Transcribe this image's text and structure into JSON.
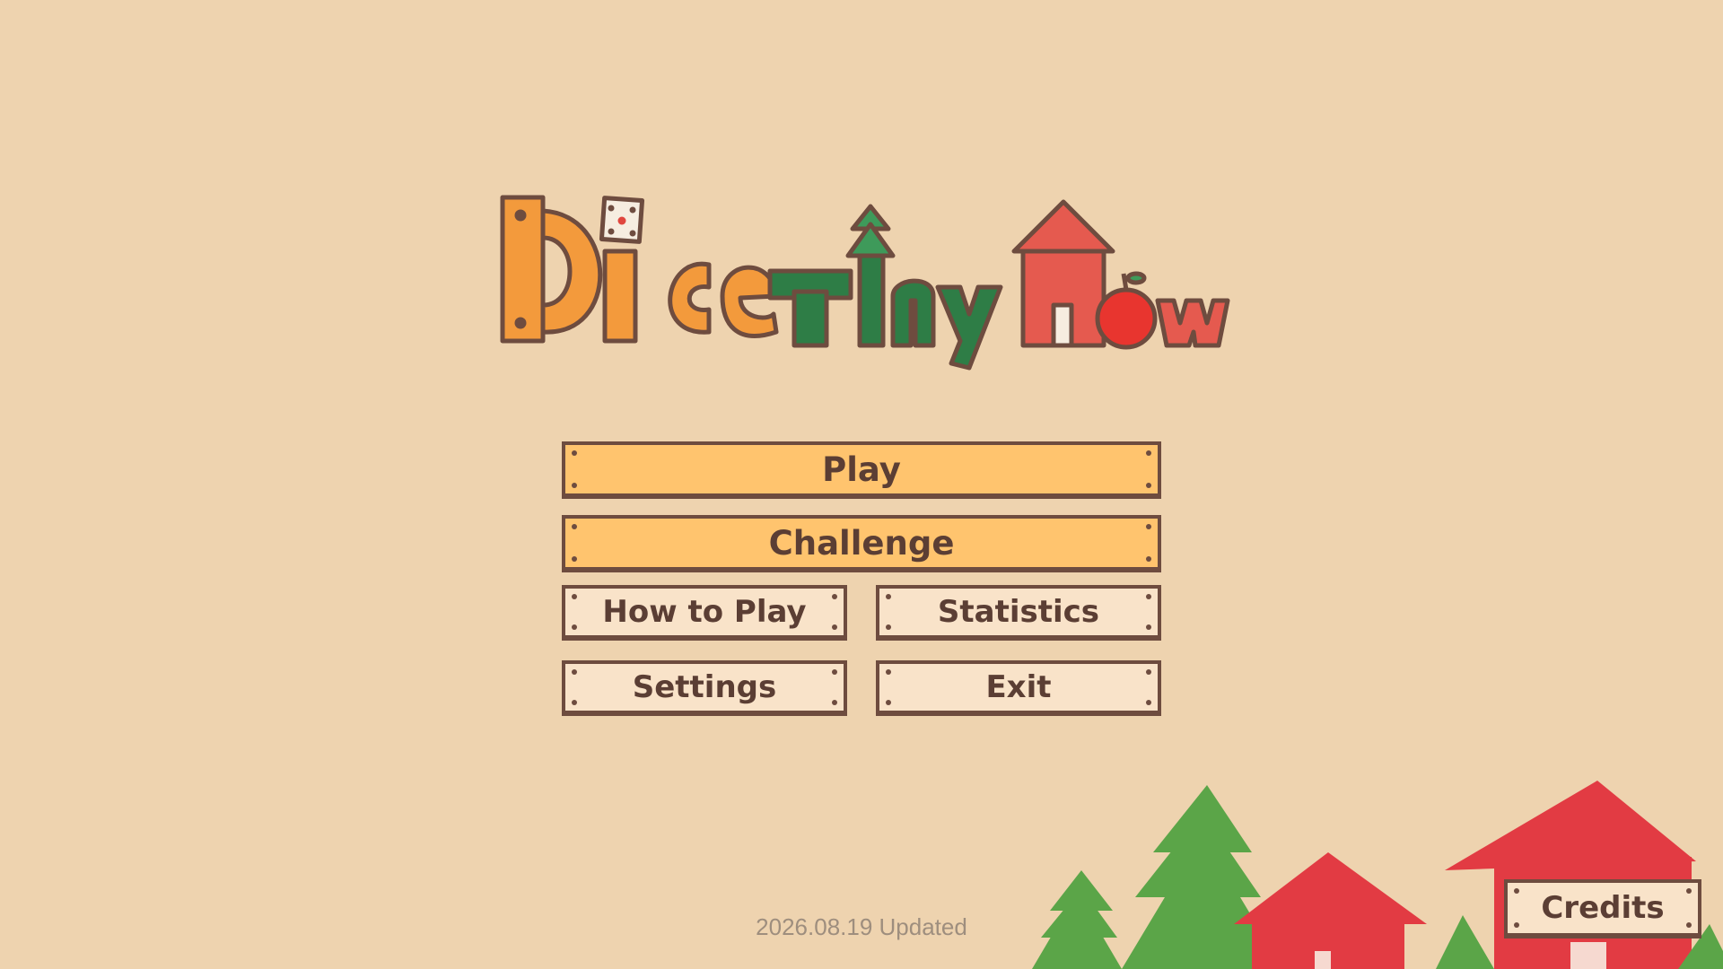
{
  "logo": {
    "alt": "Dice Tiny Town"
  },
  "menu": {
    "play": "Play",
    "challenge": "Challenge",
    "how_to_play": "How to Play",
    "statistics": "Statistics",
    "settings": "Settings",
    "exit": "Exit"
  },
  "credits": "Credits",
  "version_text": "2026.08.19 Updated",
  "colors": {
    "background": "#EED3AF",
    "primary_button": "#FFC46E",
    "secondary_button": "#F9E3C9",
    "text_brown": "#5B3E34",
    "logo_orange": "#F39A3C",
    "logo_green": "#2E7D46",
    "logo_red": "#E55A4F",
    "tree_green": "#5BA548",
    "house_red": "#E23B43"
  }
}
